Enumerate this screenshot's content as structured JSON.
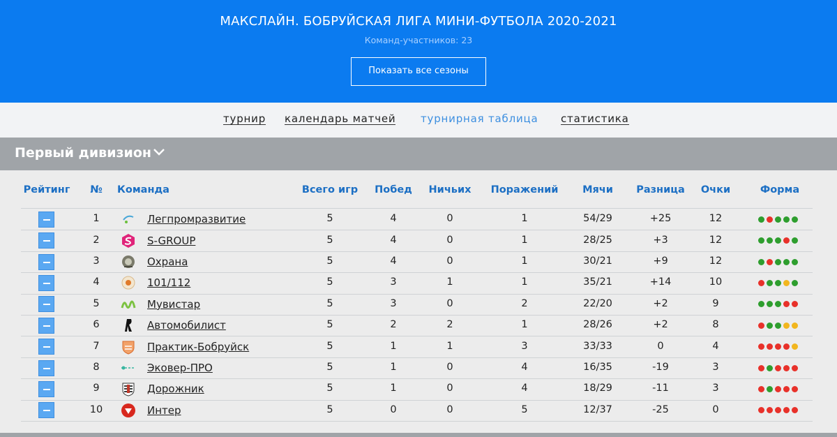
{
  "header": {
    "title": "МАКСЛАЙН. БОБРУЙСКАЯ ЛИГА МИНИ-ФУТБОЛА 2020-2021",
    "teams_count": "Команд-участников: 23",
    "show_seasons_label": "Показать все сезоны"
  },
  "nav": {
    "items": [
      {
        "label": "турнир",
        "active": false
      },
      {
        "label": "календарь матчей",
        "active": false
      },
      {
        "label": "турнирная таблица",
        "active": true
      },
      {
        "label": "статистика",
        "active": false
      }
    ]
  },
  "division": {
    "title": "Первый дивизион"
  },
  "table": {
    "headers": {
      "rating": "Рейтинг",
      "num": "№",
      "team": "Команда",
      "games": "Всего игр",
      "wins": "Побед",
      "draws": "Ничьих",
      "losses": "Поражений",
      "goals": "Мячи",
      "diff": "Разница",
      "points": "Очки",
      "form": "Форма"
    },
    "colors": {
      "W": "#2e9e2e",
      "L": "#e8312a",
      "D": "#f2b61e"
    },
    "rows": [
      {
        "num": "1",
        "team": "Легпромразвитие",
        "logo": "legprom-logo",
        "games": "5",
        "wins": "4",
        "draws": "0",
        "losses": "1",
        "goals": "54/29",
        "diff": "+25",
        "points": "12",
        "form": [
          "W",
          "L",
          "W",
          "W",
          "W"
        ]
      },
      {
        "num": "2",
        "team": "S-GROUP",
        "logo": "s-group-logo",
        "games": "5",
        "wins": "4",
        "draws": "0",
        "losses": "1",
        "goals": "28/25",
        "diff": "+3",
        "points": "12",
        "form": [
          "W",
          "W",
          "W",
          "L",
          "W"
        ]
      },
      {
        "num": "3",
        "team": "Охрана",
        "logo": "okhrana-logo",
        "games": "5",
        "wins": "4",
        "draws": "0",
        "losses": "1",
        "goals": "30/21",
        "diff": "+9",
        "points": "12",
        "form": [
          "W",
          "L",
          "W",
          "W",
          "W"
        ]
      },
      {
        "num": "4",
        "team": "101/112",
        "logo": "101-112-logo",
        "games": "5",
        "wins": "3",
        "draws": "1",
        "losses": "1",
        "goals": "35/21",
        "diff": "+14",
        "points": "10",
        "form": [
          "L",
          "W",
          "W",
          "D",
          "W"
        ]
      },
      {
        "num": "5",
        "team": "Мувистар",
        "logo": "movistar-logo",
        "games": "5",
        "wins": "3",
        "draws": "0",
        "losses": "2",
        "goals": "22/20",
        "diff": "+2",
        "points": "9",
        "form": [
          "W",
          "W",
          "W",
          "L",
          "L"
        ]
      },
      {
        "num": "6",
        "team": "Автомобилист",
        "logo": "avtomobilist-logo",
        "games": "5",
        "wins": "2",
        "draws": "2",
        "losses": "1",
        "goals": "28/26",
        "diff": "+2",
        "points": "8",
        "form": [
          "L",
          "W",
          "W",
          "D",
          "D"
        ]
      },
      {
        "num": "7",
        "team": "Практик-Бобруйск",
        "logo": "praktik-logo",
        "games": "5",
        "wins": "1",
        "draws": "1",
        "losses": "3",
        "goals": "33/33",
        "diff": "0",
        "points": "4",
        "form": [
          "L",
          "L",
          "L",
          "L",
          "D"
        ]
      },
      {
        "num": "8",
        "team": "Эковер-ПРО",
        "logo": "ekover-logo",
        "games": "5",
        "wins": "1",
        "draws": "0",
        "losses": "4",
        "goals": "16/35",
        "diff": "-19",
        "points": "3",
        "form": [
          "L",
          "W",
          "L",
          "L",
          "L"
        ]
      },
      {
        "num": "9",
        "team": "Дорожник",
        "logo": "dorozhnik-logo",
        "games": "5",
        "wins": "1",
        "draws": "0",
        "losses": "4",
        "goals": "18/29",
        "diff": "-11",
        "points": "3",
        "form": [
          "L",
          "W",
          "L",
          "L",
          "L"
        ]
      },
      {
        "num": "10",
        "team": "Интер",
        "logo": "inter-logo",
        "games": "5",
        "wins": "0",
        "draws": "0",
        "losses": "5",
        "goals": "12/37",
        "diff": "-25",
        "points": "0",
        "form": [
          "L",
          "L",
          "L",
          "L",
          "L"
        ]
      }
    ]
  }
}
